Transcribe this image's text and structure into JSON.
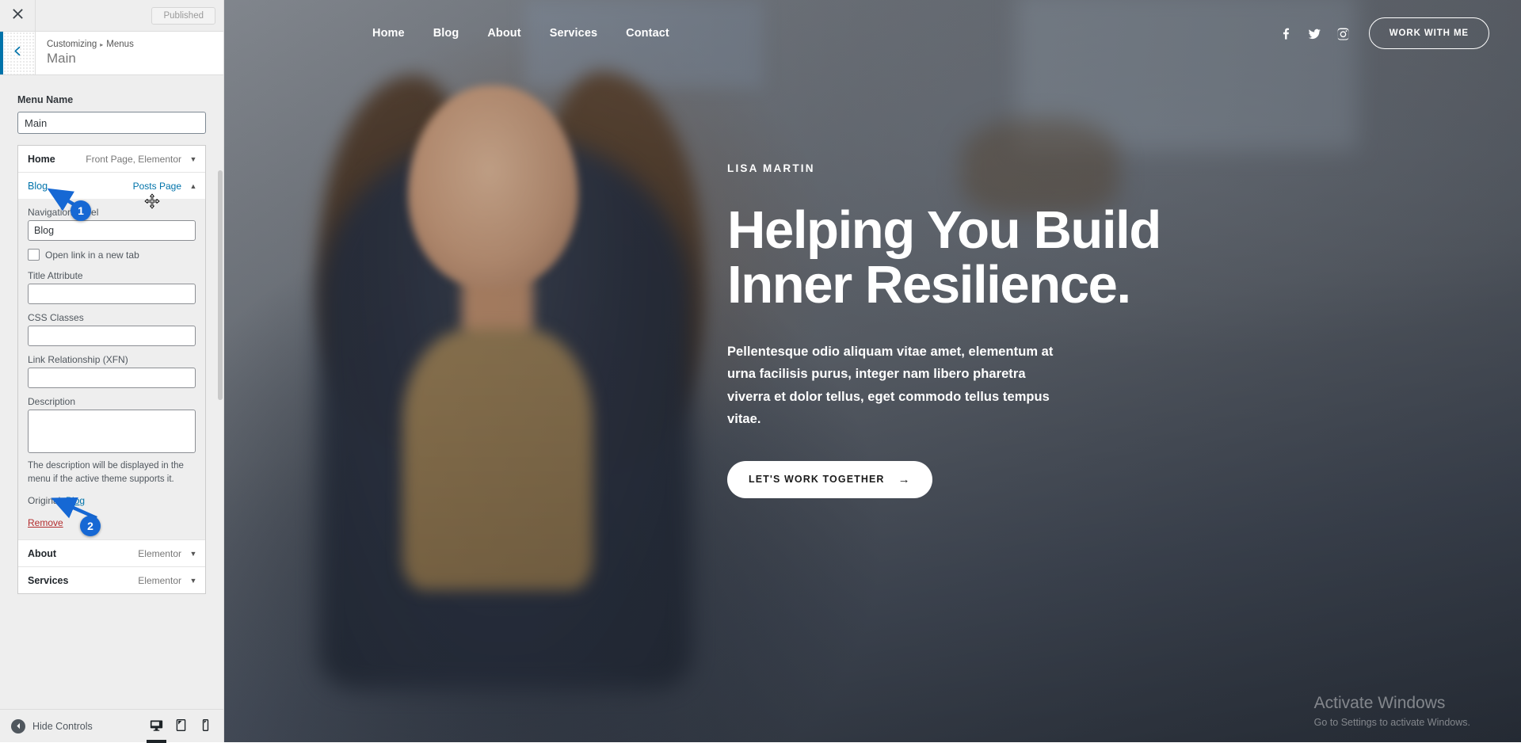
{
  "customizer": {
    "close_label": "Close",
    "publish_label": "Published",
    "breadcrumb": {
      "root": "Customizing",
      "separator": "▸",
      "section": "Menus"
    },
    "panel_title": "Main",
    "menu_name_label": "Menu Name",
    "menu_name_value": "Main",
    "menu_name_placeholder": "",
    "items": [
      {
        "title": "Home",
        "type": "Front Page, Elementor",
        "expanded": false,
        "caret": "▼"
      },
      {
        "title": "Blog",
        "type": "Posts Page",
        "expanded": true,
        "caret": "▲"
      },
      {
        "title": "About",
        "type": "Elementor",
        "expanded": false,
        "caret": "▼"
      },
      {
        "title": "Services",
        "type": "Elementor",
        "expanded": false,
        "caret": "▼"
      }
    ],
    "item_form": {
      "nav_label_label": "Navigation Label",
      "nav_label_value": "Blog",
      "new_tab_label": "Open link in a new tab",
      "new_tab_checked": false,
      "title_attr_label": "Title Attribute",
      "title_attr_value": "",
      "css_classes_label": "CSS Classes",
      "css_classes_value": "",
      "xfn_label": "Link Relationship (XFN)",
      "xfn_value": "",
      "description_label": "Description",
      "description_value": "",
      "description_help": "The description will be displayed in the menu if the active theme supports it.",
      "original_label": "Original:",
      "original_link": "Blog",
      "remove_label": "Remove"
    },
    "footer": {
      "hide_controls_label": "Hide Controls",
      "devices": [
        {
          "name": "desktop",
          "active": true
        },
        {
          "name": "tablet",
          "active": false
        },
        {
          "name": "mobile",
          "active": false
        }
      ]
    },
    "accent_color": "#0073aa",
    "remove_color": "#b32d2e"
  },
  "preview": {
    "nav": {
      "links": [
        "Home",
        "Blog",
        "About",
        "Services",
        "Contact"
      ],
      "socials": [
        "facebook-icon",
        "twitter-icon",
        "instagram-icon"
      ],
      "cta_label": "WORK WITH ME"
    },
    "hero": {
      "eyebrow": "LISA MARTIN",
      "headline_line1": "Helping You Build",
      "headline_line2": "Inner Resilience.",
      "paragraph": "Pellentesque odio aliquam vitae amet, elementum at urna facilisis purus, integer nam libero pharetra viverra et dolor tellus, eget commodo tellus tempus vitae.",
      "cta_label": "LET'S WORK TOGETHER",
      "cta_arrow": "→"
    },
    "watermark": {
      "title": "Activate Windows",
      "subtitle": "Go to Settings to activate Windows."
    }
  },
  "annotations": [
    {
      "id": "1",
      "label": "1"
    },
    {
      "id": "2",
      "label": "2"
    }
  ]
}
